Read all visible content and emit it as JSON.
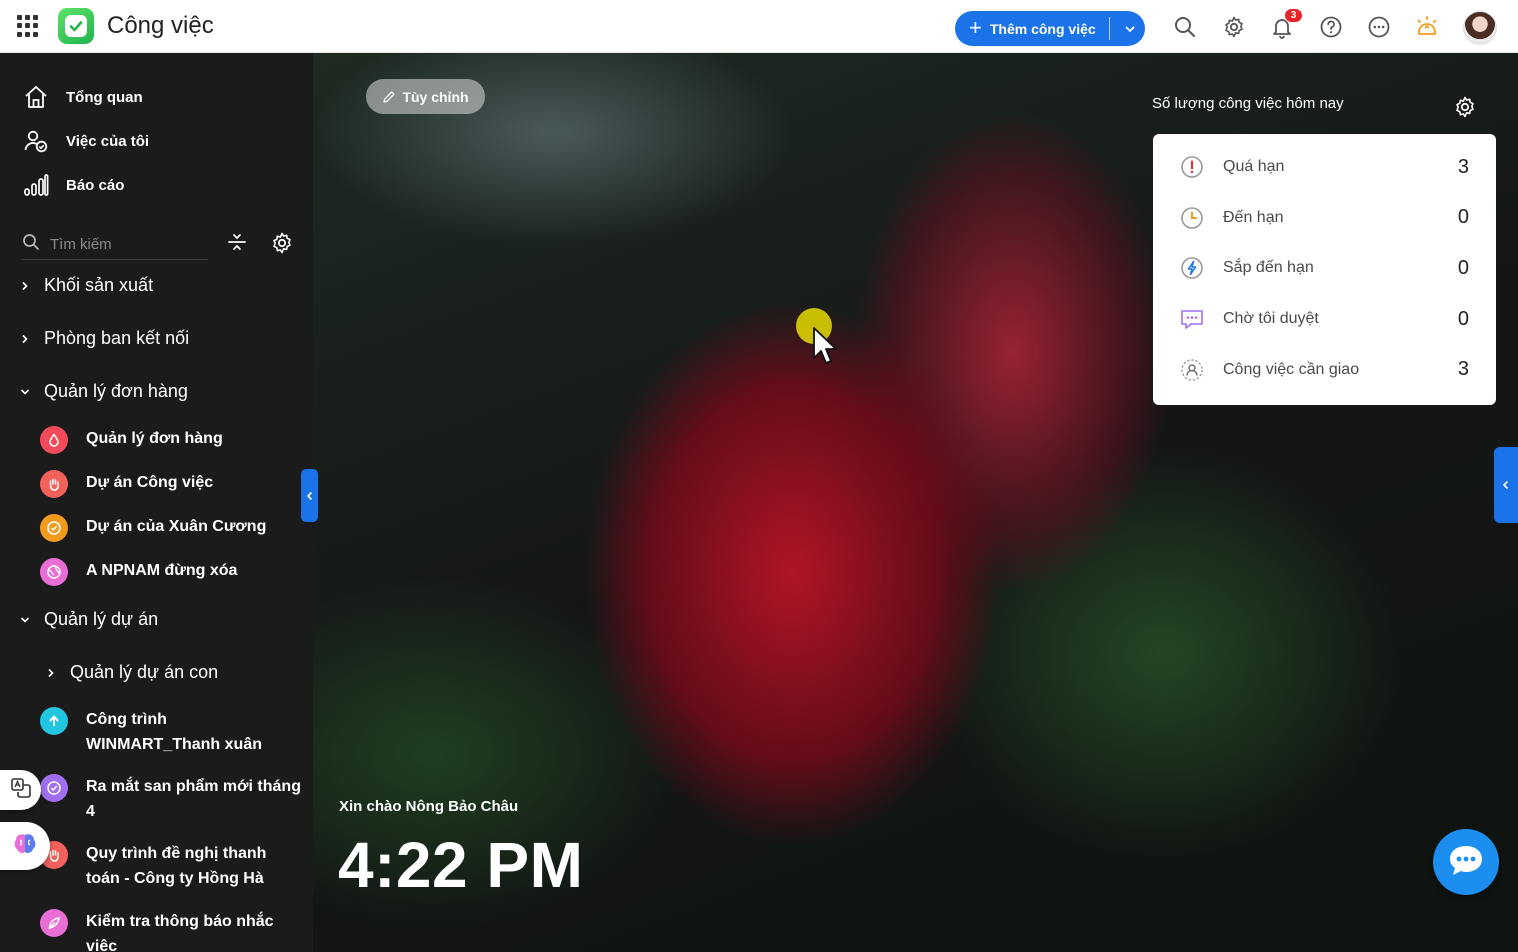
{
  "app": {
    "title": "Công việc",
    "logo_icon": "check-square-icon"
  },
  "header": {
    "add_task_label": "Thêm công việc",
    "notification_count": "3",
    "icons": [
      "search-icon",
      "gear-icon",
      "bell-icon",
      "help-icon",
      "more-icon",
      "lightbulb-icon"
    ],
    "accent": "#1a73e8"
  },
  "sidebar": {
    "nav": [
      {
        "label": "Tổng quan",
        "icon": "home-icon"
      },
      {
        "label": "Việc của tôi",
        "icon": "my-tasks-icon"
      },
      {
        "label": "Báo cáo",
        "icon": "report-icon"
      }
    ],
    "search_placeholder": "Tìm kiếm",
    "groups": [
      {
        "label": "Khối sản xuất",
        "expanded": false
      },
      {
        "label": "Phòng ban kết nối",
        "expanded": false
      },
      {
        "label": "Quản lý đơn hàng",
        "expanded": true
      },
      {
        "label": "Quản lý dự án",
        "expanded": true
      },
      {
        "label": "Quản lý dự án con",
        "expanded": false
      }
    ],
    "projects": [
      {
        "label": "Quản lý đơn hàng",
        "color": "#f24b5a",
        "icon": "drop-icon"
      },
      {
        "label": "Dự án Công việc",
        "color": "#f2625a",
        "icon": "hand-icon"
      },
      {
        "label": "Dự án của Xuân Cương",
        "color": "#f29b1d",
        "icon": "check-circle-icon"
      },
      {
        "label": "A NPNAM đừng xóa",
        "color": "#e96fd6",
        "icon": "globe-icon"
      },
      {
        "label": "Công trình WINMART_Thanh xuân",
        "color": "#23c6e0",
        "icon": "upload-icon"
      },
      {
        "label": "Ra mắt san phẩm mới tháng 4",
        "color": "#a06ff0",
        "icon": "check-circle-icon"
      },
      {
        "label": "Quy trình đề nghị thanh toán - Công ty Hồng Hà",
        "color": "#f2625a",
        "icon": "hand-icon"
      },
      {
        "label": "Kiểm tra thông báo nhắc việc",
        "color": "#e96fd6",
        "icon": "leaf-icon"
      }
    ]
  },
  "main": {
    "customize_label": "Tùy chỉnh",
    "stats_title": "Số lượng công việc hôm nay",
    "stats": [
      {
        "label": "Quá hạn",
        "value": "3",
        "icon": "alert-icon",
        "color": "#e5252a"
      },
      {
        "label": "Đến hạn",
        "value": "0",
        "icon": "clock-icon",
        "color": "#f29b1d"
      },
      {
        "label": "Sắp đến hạn",
        "value": "0",
        "icon": "lightning-icon",
        "color": "#1a73e8"
      },
      {
        "label": "Chờ tôi duyệt",
        "value": "0",
        "icon": "comment-icon",
        "color": "#a06ff0"
      },
      {
        "label": "Công việc cần giao",
        "value": "3",
        "icon": "user-icon",
        "color": "#8a8a8a"
      }
    ],
    "greeting": "Xin chào Nông Bảo Châu",
    "time": "4:22 PM"
  }
}
